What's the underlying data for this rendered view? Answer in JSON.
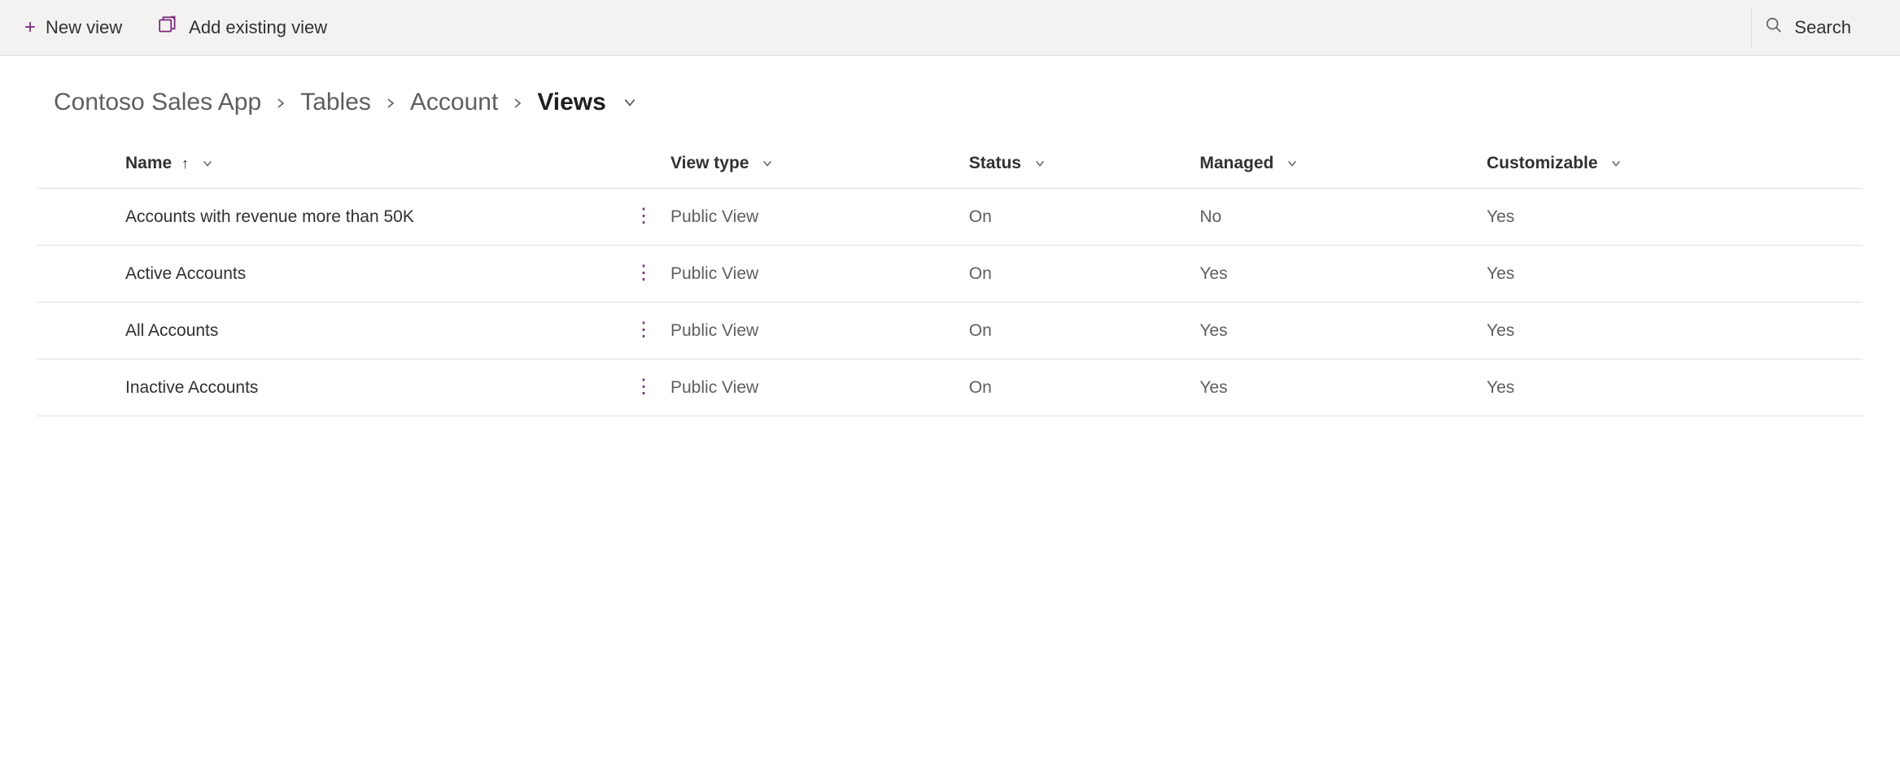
{
  "toolbar": {
    "new_view_label": "New view",
    "add_existing_view_label": "Add existing view",
    "search_label": "Search"
  },
  "breadcrumb": {
    "items": [
      {
        "label": "Contoso Sales App"
      },
      {
        "label": "Tables"
      },
      {
        "label": "Account"
      },
      {
        "label": "Views"
      }
    ]
  },
  "table": {
    "columns": {
      "name": "Name",
      "view_type": "View type",
      "status": "Status",
      "managed": "Managed",
      "customizable": "Customizable"
    },
    "rows": [
      {
        "name": "Accounts with revenue more than 50K",
        "view_type": "Public View",
        "status": "On",
        "managed": "No",
        "customizable": "Yes"
      },
      {
        "name": "Active Accounts",
        "view_type": "Public View",
        "status": "On",
        "managed": "Yes",
        "customizable": "Yes"
      },
      {
        "name": "All Accounts",
        "view_type": "Public View",
        "status": "On",
        "managed": "Yes",
        "customizable": "Yes"
      },
      {
        "name": "Inactive Accounts",
        "view_type": "Public View",
        "status": "On",
        "managed": "Yes",
        "customizable": "Yes"
      }
    ]
  }
}
